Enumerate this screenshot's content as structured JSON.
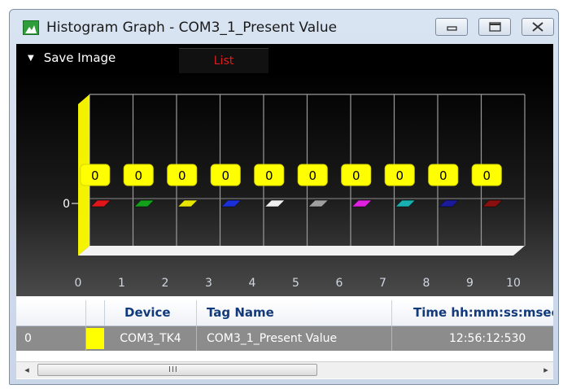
{
  "window": {
    "title": "Histogram Graph - COM3_1_Present Value"
  },
  "toolbar": {
    "save_image_label": "Save Image",
    "list_tab_label": "List"
  },
  "chart_data": {
    "type": "bar",
    "categories": [
      "0",
      "1",
      "2",
      "3",
      "4",
      "5",
      "6",
      "7",
      "8",
      "9"
    ],
    "x_ticks": [
      "0",
      "1",
      "2",
      "3",
      "4",
      "5",
      "6",
      "7",
      "8",
      "9",
      "10"
    ],
    "y_ticks": [
      "0"
    ],
    "values": [
      0,
      0,
      0,
      0,
      0,
      0,
      0,
      0,
      0,
      0
    ],
    "value_labels": [
      "0",
      "0",
      "0",
      "0",
      "0",
      "0",
      "0",
      "0",
      "0",
      "0"
    ],
    "bar_colors": [
      "#e0161b",
      "#13a01a",
      "#e6e600",
      "#1a2fd8",
      "#f0f0f0",
      "#a0a0a0",
      "#e020e0",
      "#18b0b0",
      "#1a1a9a",
      "#8a1010"
    ],
    "highlight_color": "#ffff00",
    "grid": true
  },
  "table": {
    "columns": [
      "",
      "",
      "Device",
      "Tag Name",
      "Time hh:mm:ss:msec"
    ],
    "rows": [
      {
        "index": "0",
        "color": "#ffff00",
        "device": "COM3_TK4",
        "tag_name": "COM3_1_Present Value",
        "time": "12:56:12:530"
      }
    ]
  },
  "scrollbar": {
    "left_arrow": "◂",
    "right_arrow": "▸",
    "grip": "III"
  }
}
